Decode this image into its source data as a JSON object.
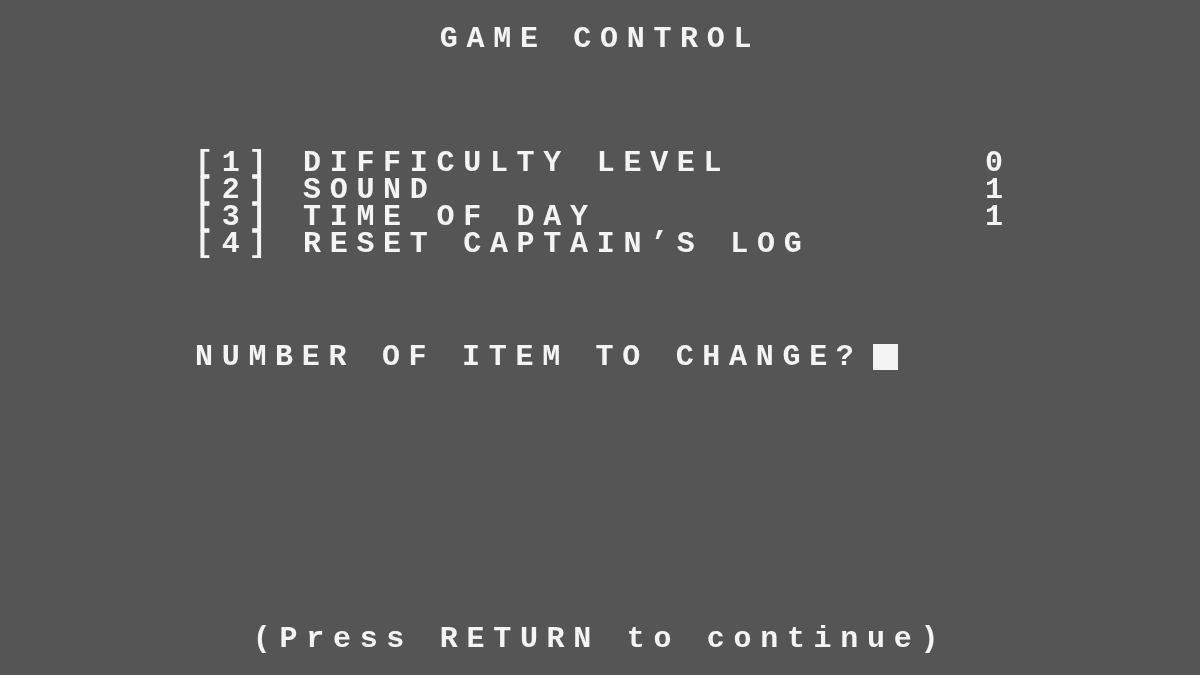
{
  "title": "GAME CONTROL",
  "options": [
    {
      "key": "[1]",
      "label": "DIFFICULTY LEVEL",
      "value": "0"
    },
    {
      "key": "[2]",
      "label": "SOUND",
      "value": "1"
    },
    {
      "key": "[3]",
      "label": "TIME OF DAY",
      "value": "1"
    },
    {
      "key": "[4]",
      "label": "RESET CAPTAIN’S LOG"
    }
  ],
  "prompt": {
    "text": "NUMBER OF ITEM TO CHANGE?",
    "cursor_visible": true
  },
  "footer": "(Press RETURN to continue)"
}
